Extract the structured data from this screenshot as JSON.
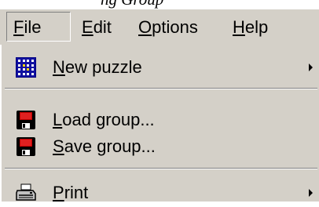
{
  "caption": {
    "text": "ng Group"
  },
  "menubar": {
    "items": [
      {
        "mnemonic": "F",
        "rest": "ile"
      },
      {
        "mnemonic": "E",
        "rest": "dit"
      },
      {
        "mnemonic": "O",
        "rest": "ptions"
      },
      {
        "mnemonic": "H",
        "rest": "elp"
      }
    ]
  },
  "file_menu": {
    "items": [
      {
        "mnemonic": "N",
        "rest": "ew puzzle",
        "icon": "puzzle-grid-icon",
        "has_submenu": true
      },
      {
        "mnemonic": "L",
        "rest": "oad group...",
        "icon": "floppy-disk-icon",
        "has_submenu": false
      },
      {
        "mnemonic": "S",
        "rest": "ave group...",
        "icon": "floppy-disk-icon",
        "has_submenu": false
      },
      {
        "mnemonic": "P",
        "rest": "rint",
        "icon": "printer-icon",
        "has_submenu": true
      }
    ]
  },
  "colors": {
    "menu_background": "#d4d0c8",
    "puzzle_icon_blue": "#000080",
    "floppy_red": "#c00000"
  }
}
